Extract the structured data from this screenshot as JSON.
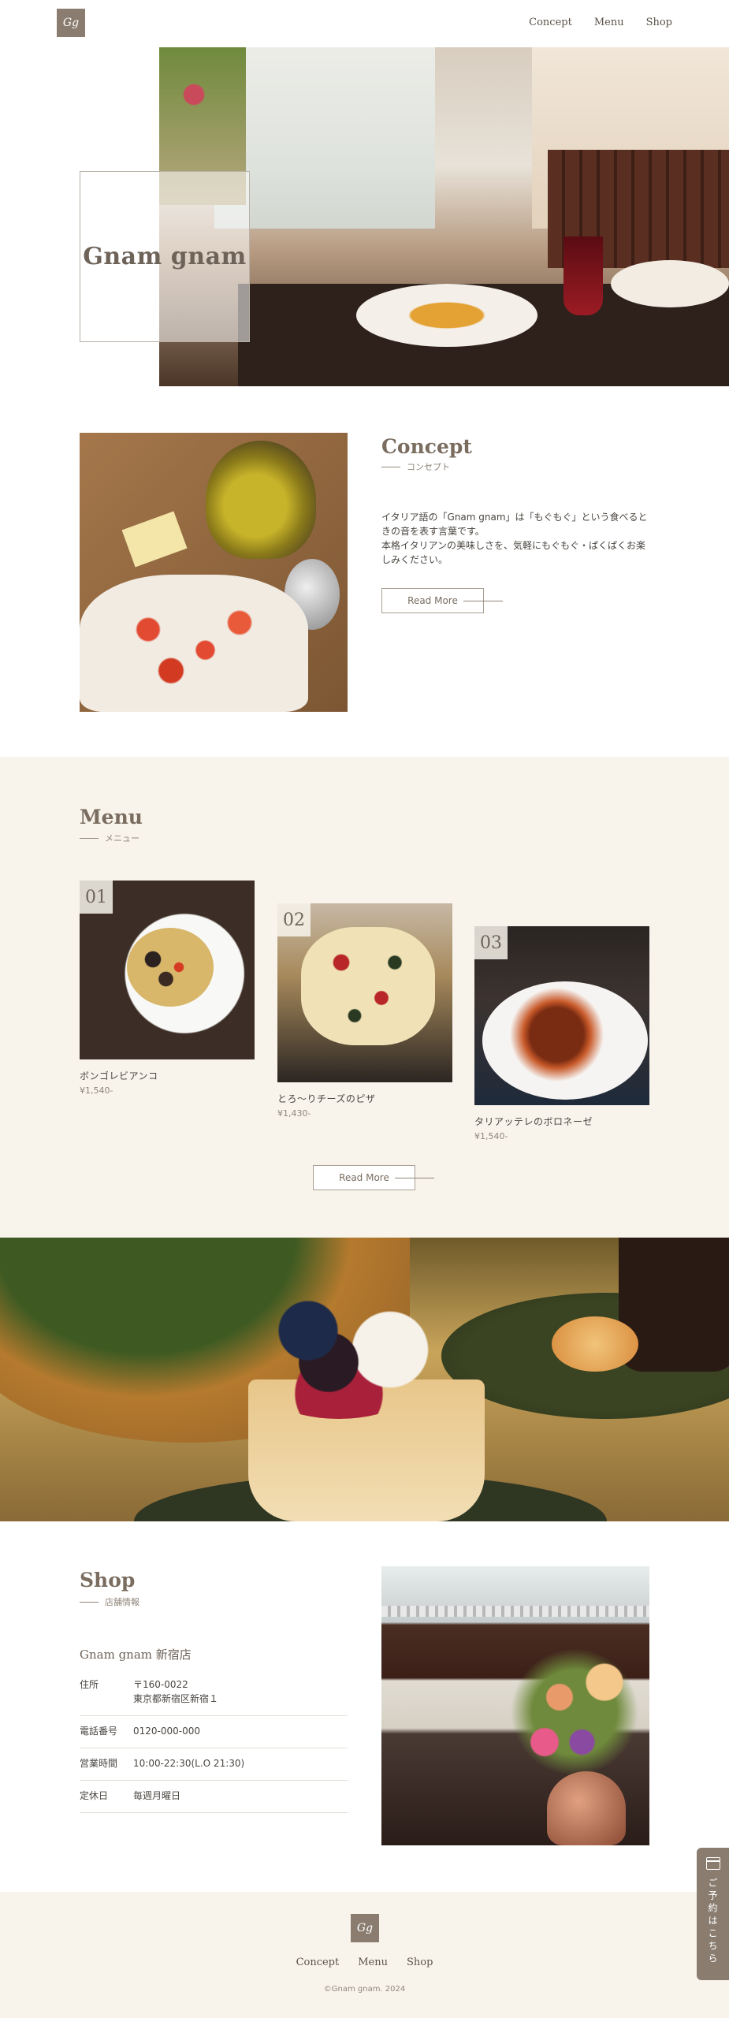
{
  "header": {
    "logo_text": "Gg",
    "nav": [
      "Concept",
      "Menu",
      "Shop"
    ]
  },
  "hero": {
    "title": "Gnam gnam"
  },
  "concept": {
    "title": "Concept",
    "subtitle": "コンセプト",
    "body_1": "イタリア語の「Gnam gnam」は「もぐもぐ」という食べるときの音を表す言葉です。",
    "body_2": "本格イタリアンの美味しさを、気軽にもぐもぐ・ぱくぱくお楽しみください。",
    "button": "Read More"
  },
  "menu": {
    "title": "Menu",
    "subtitle": "メニュー",
    "items": [
      {
        "num": "01",
        "name": "ボンゴレビアンコ",
        "price": "¥1,540-"
      },
      {
        "num": "02",
        "name": "とろ〜りチーズのピザ",
        "price": "¥1,430-"
      },
      {
        "num": "03",
        "name": "タリアッテレのボロネーゼ",
        "price": "¥1,540-"
      }
    ],
    "button": "Read More"
  },
  "shop": {
    "title": "Shop",
    "subtitle": "店舗情報",
    "store_name": "Gnam gnam 新宿店",
    "rows": [
      {
        "label": "住所",
        "value_1": "〒160-0022",
        "value_2": "東京都新宿区新宿１"
      },
      {
        "label": "電話番号",
        "value_1": "0120-000-000"
      },
      {
        "label": "営業時間",
        "value_1": "10:00-22:30(L.O 21:30)"
      },
      {
        "label": "定休日",
        "value_1": "毎週月曜日"
      }
    ]
  },
  "footer": {
    "logo_text": "Gg",
    "nav": [
      "Concept",
      "Menu",
      "Shop"
    ],
    "copyright": "©Gnam gnam. 2024"
  },
  "reserve": {
    "label": "ご予約はこちら"
  },
  "colors": {
    "accent": "#8a7d70",
    "section_bg": "#f8f4ec",
    "heading": "#7a6d60"
  }
}
